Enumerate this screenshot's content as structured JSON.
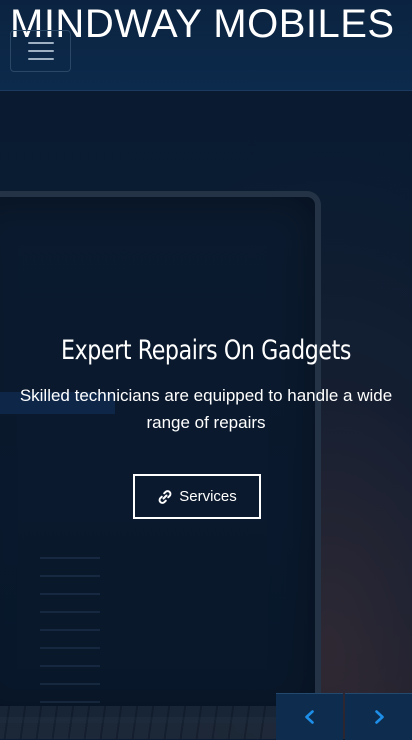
{
  "header": {
    "brand": "MINDWAY MOBILES",
    "menu_icon": "hamburger-menu-icon"
  },
  "hero": {
    "title": "Expert Repairs On Gadgets",
    "subtitle": "Skilled technicians are equipped to handle a wide range of repairs",
    "button_label": "Services",
    "button_icon": "link-icon"
  },
  "carousel": {
    "prev_icon": "chevron-left-icon",
    "next_icon": "chevron-right-icon",
    "accent_color": "#1e8fe8"
  }
}
